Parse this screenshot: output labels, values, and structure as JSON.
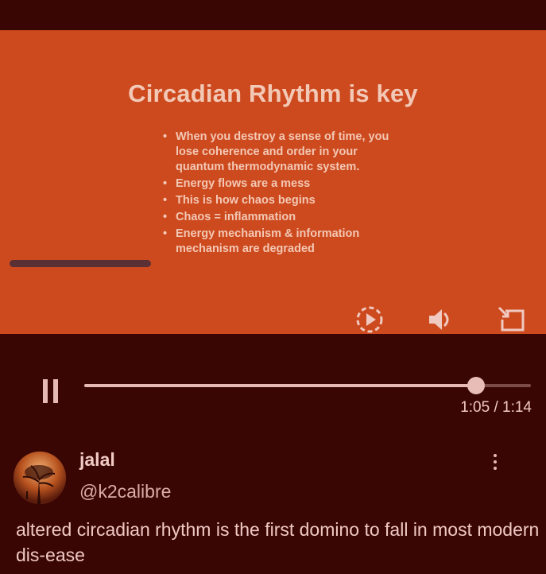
{
  "slide": {
    "title": "Circadian Rhythm is key",
    "bullets": [
      "When you destroy a sense of time, you lose coherence and order in your quantum thermodynamic system.",
      "Energy flows are a mess",
      "This is how chaos begins",
      "Chaos = inflammation",
      "Energy mechanism & information mechanism are degraded"
    ]
  },
  "video_controls": {
    "icons": [
      "replay-icon",
      "volume-icon",
      "fullscreen-icon"
    ]
  },
  "player": {
    "time": "1:05 / 1:14",
    "progress": 0.878
  },
  "post": {
    "username": "jalal",
    "handle": "@k2calibre",
    "text": "altered circadian rhythm is the first domino to fall in most modern dis-ease"
  },
  "colors": {
    "background": "#3a0604",
    "video": "#cd4a1f",
    "accent": "#e6b9b4"
  }
}
